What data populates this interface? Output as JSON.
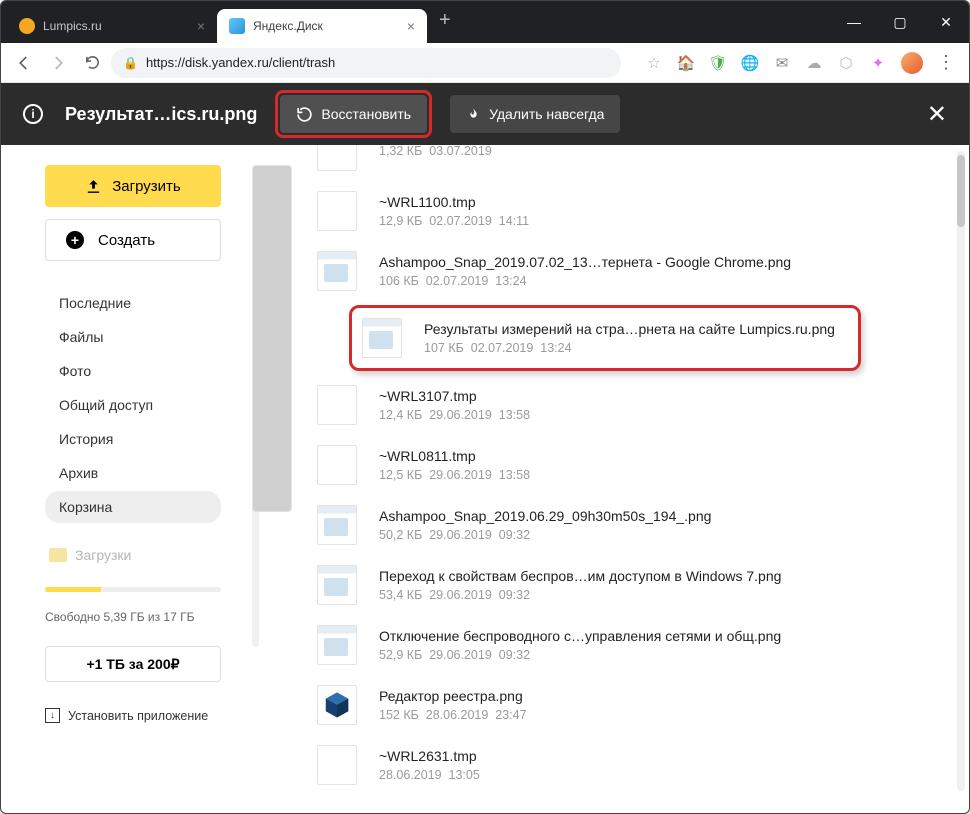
{
  "tabs": [
    {
      "title": "Lumpics.ru",
      "active": false
    },
    {
      "title": "Яндекс.Диск",
      "active": true
    }
  ],
  "url": "https://disk.yandex.ru/client/trash",
  "action_bar": {
    "selected_name": "Результат…ics.ru.png",
    "restore": "Восстановить",
    "delete_forever": "Удалить навсегда"
  },
  "sidebar": {
    "upload": "Загрузить",
    "create": "Создать",
    "nav": [
      "Последние",
      "Файлы",
      "Фото",
      "Общий доступ",
      "История",
      "Архив",
      "Корзина"
    ],
    "active_index": 6,
    "folder": "Загрузки",
    "quota_text": "Свободно 5,39 ГБ из 17 ГБ",
    "promo": "+1 ТБ за 200₽",
    "install": "Установить приложение"
  },
  "files": [
    {
      "name": "",
      "size": "1,32 КБ",
      "date": "03.07.2019",
      "time": "",
      "thumb": "blank",
      "partial": true
    },
    {
      "name": "~WRL1100.tmp",
      "size": "12,9 КБ",
      "date": "02.07.2019",
      "time": "14:11",
      "thumb": "blank"
    },
    {
      "name": "Ashampoo_Snap_2019.07.02_13…тернета - Google Chrome.png",
      "size": "106 КБ",
      "date": "02.07.2019",
      "time": "13:24",
      "thumb": "img"
    },
    {
      "name": "Результаты измерений на стра…рнета на сайте Lumpics.ru.png",
      "size": "107 КБ",
      "date": "02.07.2019",
      "time": "13:24",
      "thumb": "img",
      "selected": true
    },
    {
      "name": "~WRL3107.tmp",
      "size": "12,4 КБ",
      "date": "29.06.2019",
      "time": "13:58",
      "thumb": "blank"
    },
    {
      "name": "~WRL0811.tmp",
      "size": "12,5 КБ",
      "date": "29.06.2019",
      "time": "13:58",
      "thumb": "blank"
    },
    {
      "name": "Ashampoo_Snap_2019.06.29_09h30m50s_194_.png",
      "size": "50,2 КБ",
      "date": "29.06.2019",
      "time": "09:32",
      "thumb": "img"
    },
    {
      "name": "Переход к свойствам беспров…им доступом в Windows 7.png",
      "size": "53,4 КБ",
      "date": "29.06.2019",
      "time": "09:32",
      "thumb": "img"
    },
    {
      "name": "Отключение беспроводного с…управления сетями и общ.png",
      "size": "52,9 КБ",
      "date": "29.06.2019",
      "time": "09:32",
      "thumb": "img"
    },
    {
      "name": "Редактор реестра.png",
      "size": "152 КБ",
      "date": "28.06.2019",
      "time": "23:47",
      "thumb": "cube"
    },
    {
      "name": "~WRL2631.tmp",
      "size": "",
      "date": "28.06.2019",
      "time": "13:05",
      "thumb": "blank"
    }
  ]
}
